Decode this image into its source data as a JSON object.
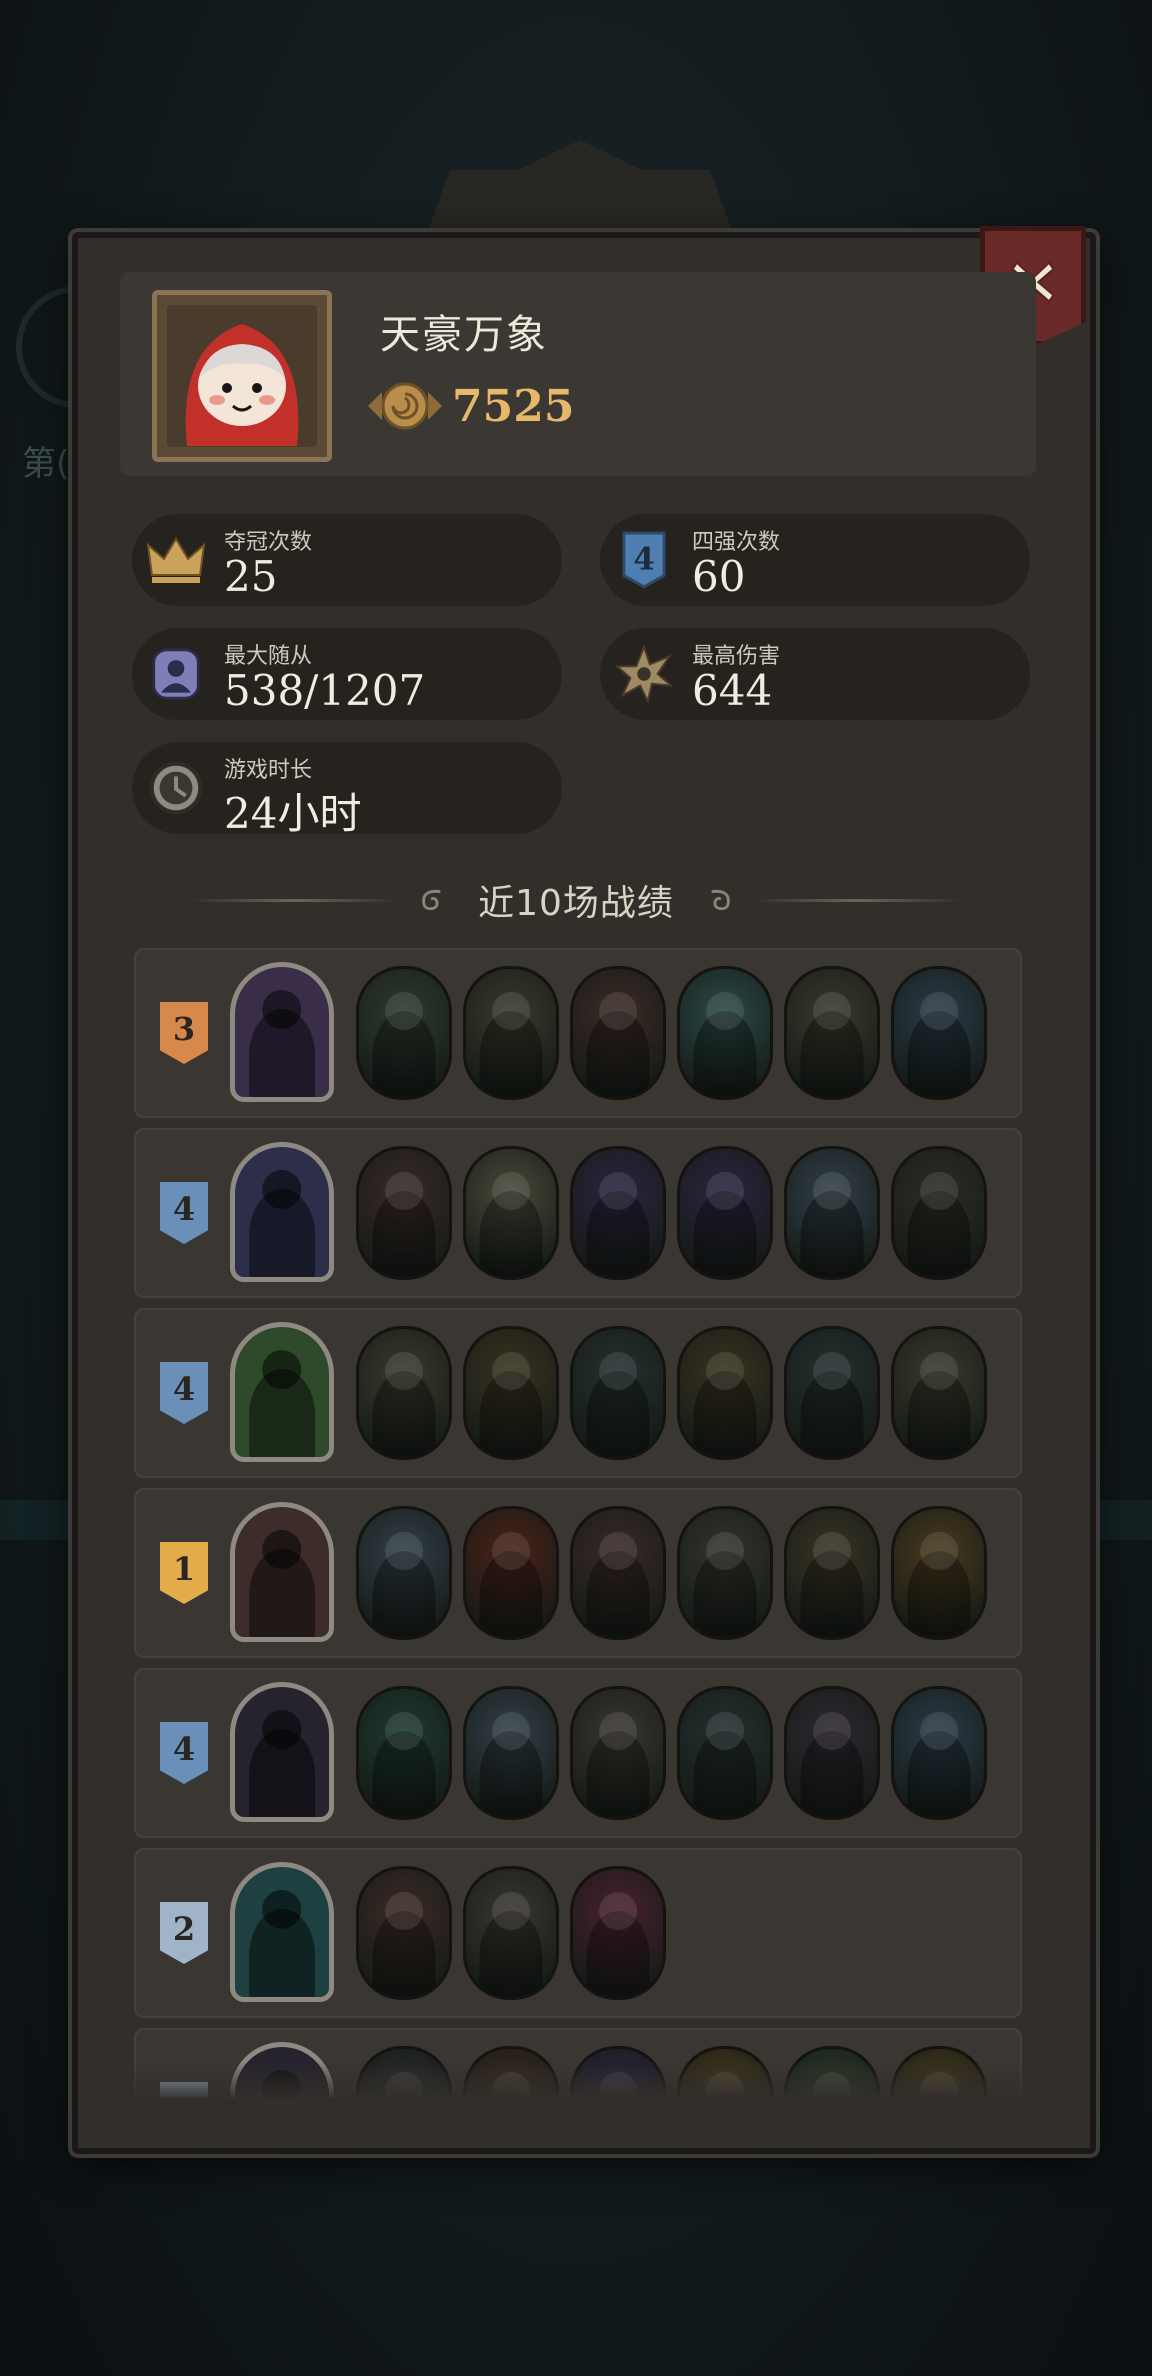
{
  "background_label": "第(",
  "profile": {
    "name": "天豪万象",
    "coin_icon": "coin-icon",
    "coins": "7525",
    "avatar_icon": "red-hood-girl-avatar"
  },
  "close_icon": "close-icon",
  "stats": [
    {
      "id": "champion",
      "icon": "crown-icon",
      "label": "夺冠次数",
      "value": "25"
    },
    {
      "id": "top4",
      "icon": "rank-4-badge-icon",
      "label": "四强次数",
      "value": "60"
    },
    {
      "id": "followers",
      "icon": "minion-portrait-icon",
      "label": "最大随从",
      "value": "538/1207"
    },
    {
      "id": "damage",
      "icon": "damage-burst-icon",
      "label": "最高伤害",
      "value": "644"
    },
    {
      "id": "playtime",
      "icon": "clock-icon",
      "label": "游戏时长",
      "value": "24小时"
    }
  ],
  "history": {
    "title": "近10场战绩",
    "matches": [
      {
        "rank": "3",
        "rank_color": "#d6894a",
        "hero": "#3a2d4a",
        "units": [
          "#2e3a30",
          "#3b3a2c",
          "#3c2a26",
          "#2c4a48",
          "#3b3a2c",
          "#2a3c4a"
        ]
      },
      {
        "rank": "4",
        "rank_color": "#6a8fb8",
        "hero": "#2c2e4a",
        "units": [
          "#3a2a28",
          "#4a4a3a",
          "#2c2440",
          "#2c2440",
          "#33404a",
          "#2e2c26"
        ]
      },
      {
        "rank": "4",
        "rank_color": "#6a8fb8",
        "hero": "#2e4a2a",
        "units": [
          "#3b3a2c",
          "#3a3320",
          "#243030",
          "#3a3320",
          "#243030",
          "#3b3a2c"
        ]
      },
      {
        "rank": "1",
        "rank_color": "#e2ac4a",
        "hero": "#3d2c2a",
        "units": [
          "#33404a",
          "#4a2218",
          "#3a2a28",
          "#34342e",
          "#3a3424",
          "#4a3a1e"
        ]
      },
      {
        "rank": "4",
        "rank_color": "#6a8fb8",
        "hero": "#26222e",
        "units": [
          "#1e3a30",
          "#33404a",
          "#3a3630",
          "#243030",
          "#2e2830",
          "#2a3c4a"
        ]
      },
      {
        "rank": "2",
        "rank_color": "#9fb4c8",
        "hero": "#1e4040",
        "units": [
          "#3c2a26",
          "#3a3630",
          "#4a2030"
        ]
      },
      {
        "rank": "",
        "rank_color": "#9fb4c8",
        "hero": "#26222e",
        "units": [
          "#2a2a2e",
          "#3c2a20",
          "#2c2440",
          "#4a3a1e",
          "#2e3a2a",
          "#4a3a1e"
        ]
      }
    ]
  }
}
